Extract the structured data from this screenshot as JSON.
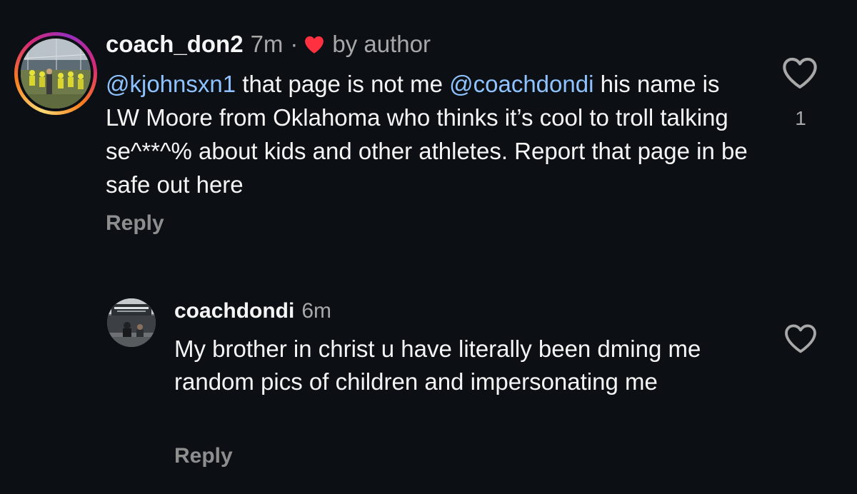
{
  "comments": [
    {
      "username": "coach_don2",
      "time": "7m",
      "separator": "·",
      "author_badge": "by author",
      "segments": [
        {
          "type": "mention",
          "text": "@kjohnsxn1"
        },
        {
          "type": "text",
          "text": " that page is not me "
        },
        {
          "type": "mention",
          "text": "@coachdondi"
        },
        {
          "type": "text",
          "text": " his name is LW Moore from Oklahoma who thinks it’s cool to troll talking se^**^% about kids and other athletes. Report that page in be safe out here"
        }
      ],
      "reply_label": "Reply",
      "like_count": "1"
    },
    {
      "username": "coachdondi",
      "time": "6m",
      "text": "My brother in christ u have literally been dming me random pics of children and impersonating me",
      "reply_label": "Reply"
    }
  ],
  "icons": {
    "like": "heart-outline-icon",
    "author_liked": "heart-filled-icon"
  },
  "colors": {
    "background": "#0c1014",
    "text": "#f5f5f5",
    "secondary": "#a8a8a8",
    "mention": "#8ec3ff",
    "heart": "#ff3040"
  }
}
